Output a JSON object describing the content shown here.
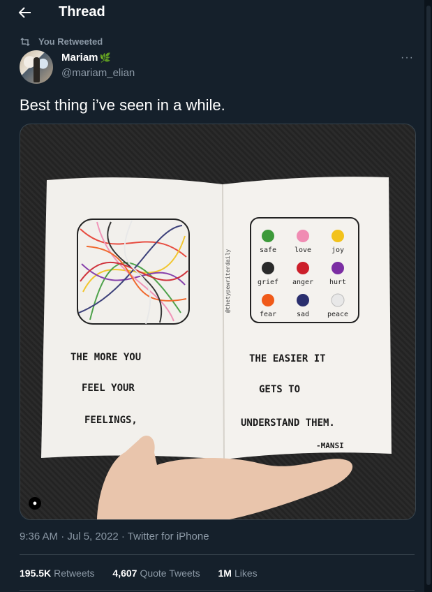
{
  "header": {
    "title": "Thread",
    "back_icon": "arrow-left-icon"
  },
  "retweet": {
    "label": "You Retweeted",
    "icon": "retweet-icon"
  },
  "author": {
    "name": "Mariam",
    "name_emoji": "🌿",
    "handle": "@mariam_elian"
  },
  "more_label": "···",
  "tweet": {
    "text": "Best thing i’ve seen in a while."
  },
  "image": {
    "credit": "@thetypewriterdaily",
    "left_text": [
      "THE MORE YOU",
      "FEEL YOUR",
      "FEELINGS,"
    ],
    "right_text": [
      "THE EASIER IT",
      "GETS TO",
      "UNDERSTAND THEM."
    ],
    "signature": "-MANSI",
    "emotions": [
      {
        "label": "safe",
        "color": "#3d9a3a"
      },
      {
        "label": "love",
        "color": "#f08cb3"
      },
      {
        "label": "joy",
        "color": "#f2c21b"
      },
      {
        "label": "grief",
        "color": "#2a2a2a"
      },
      {
        "label": "anger",
        "color": "#cc1f2a"
      },
      {
        "label": "hurt",
        "color": "#7b2ea3"
      },
      {
        "label": "fear",
        "color": "#f05a19"
      },
      {
        "label": "sad",
        "color": "#2a2f6e"
      },
      {
        "label": "peace",
        "color": "#e8e8e8"
      }
    ]
  },
  "meta": "9:36 AM · Jul 5, 2022 · Twitter for iPhone",
  "stats": {
    "retweets_value": "195.5K",
    "retweets_label": "Retweets",
    "quotes_value": "4,607",
    "quotes_label": "Quote Tweets",
    "likes_value": "1M",
    "likes_label": "Likes"
  }
}
